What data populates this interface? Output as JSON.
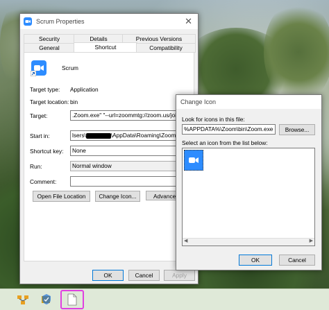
{
  "props": {
    "title": "Scrum Properties",
    "close_glyph": "✕",
    "tabs_row1": [
      "Security",
      "Details",
      "Previous Versions"
    ],
    "tabs_row2": [
      "General",
      "Shortcut",
      "Compatibility"
    ],
    "shortcut_name": "Scrum",
    "target_type_label": "Target type:",
    "target_type_value": "Application",
    "target_location_label": "Target location:",
    "target_location_value": "bin",
    "target_label": "Target:",
    "target_value": ".Zoom.exe\" \"--url=zoommtg://zoom.us/join?a",
    "start_in_label": "Start in:",
    "start_in_value_a": "lsers\\",
    "start_in_value_b": "\\AppData\\Roaming\\Zoom",
    "shortcut_key_label": "Shortcut key:",
    "shortcut_key_value": "None",
    "run_label": "Run:",
    "run_value": "Normal window",
    "comment_label": "Comment:",
    "comment_value": "",
    "btn_open_location": "Open File Location",
    "btn_change_icon": "Change Icon...",
    "btn_advanced": "Advanced",
    "btn_ok": "OK",
    "btn_cancel": "Cancel",
    "btn_apply": "Apply"
  },
  "change_icon": {
    "title": "Change Icon",
    "look_for_label": "Look for icons in this file:",
    "file_path": "%APPDATA%\\Zoom\\bin\\Zoom.exe",
    "browse_label": "Browse...",
    "select_label": "Select an icon from the list below:",
    "btn_ok": "OK",
    "btn_cancel": "Cancel"
  },
  "taskbar": {
    "icons": [
      "network-icon",
      "security-icon",
      "document-icon"
    ]
  }
}
